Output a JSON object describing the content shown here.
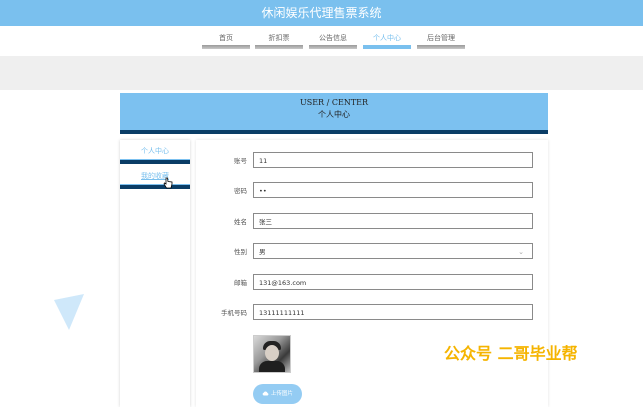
{
  "app": {
    "title": "休闲娱乐代理售票系统"
  },
  "nav": {
    "items": [
      {
        "label": "首页"
      },
      {
        "label": "折扣票"
      },
      {
        "label": "公告信息"
      },
      {
        "label": "个人中心"
      },
      {
        "label": "后台管理"
      }
    ],
    "active_index": 3
  },
  "page_header": {
    "title_en": "USER / CENTER",
    "title_zh": "个人中心"
  },
  "sidebar": {
    "items": [
      {
        "label": "个人中心"
      },
      {
        "label": "我的收藏"
      }
    ]
  },
  "form": {
    "account": {
      "label": "账号",
      "value": "11"
    },
    "password": {
      "label": "密码",
      "value": "••"
    },
    "name": {
      "label": "姓名",
      "value": "张三"
    },
    "gender": {
      "label": "性别",
      "value": "男"
    },
    "email": {
      "label": "邮箱",
      "value": "131@163.com"
    },
    "phone": {
      "label": "手机号码",
      "value": "13111111111"
    },
    "upload_label": "上传图片"
  },
  "watermark": {
    "text": "公众号 二哥毕业帮"
  },
  "colors": {
    "accent": "#7ac0ee",
    "dark_accent": "#0a3d66",
    "watermark": "#f5b400"
  },
  "icons": {
    "dropdown": "chevron-down-icon",
    "upload": "cloud-upload-icon"
  }
}
